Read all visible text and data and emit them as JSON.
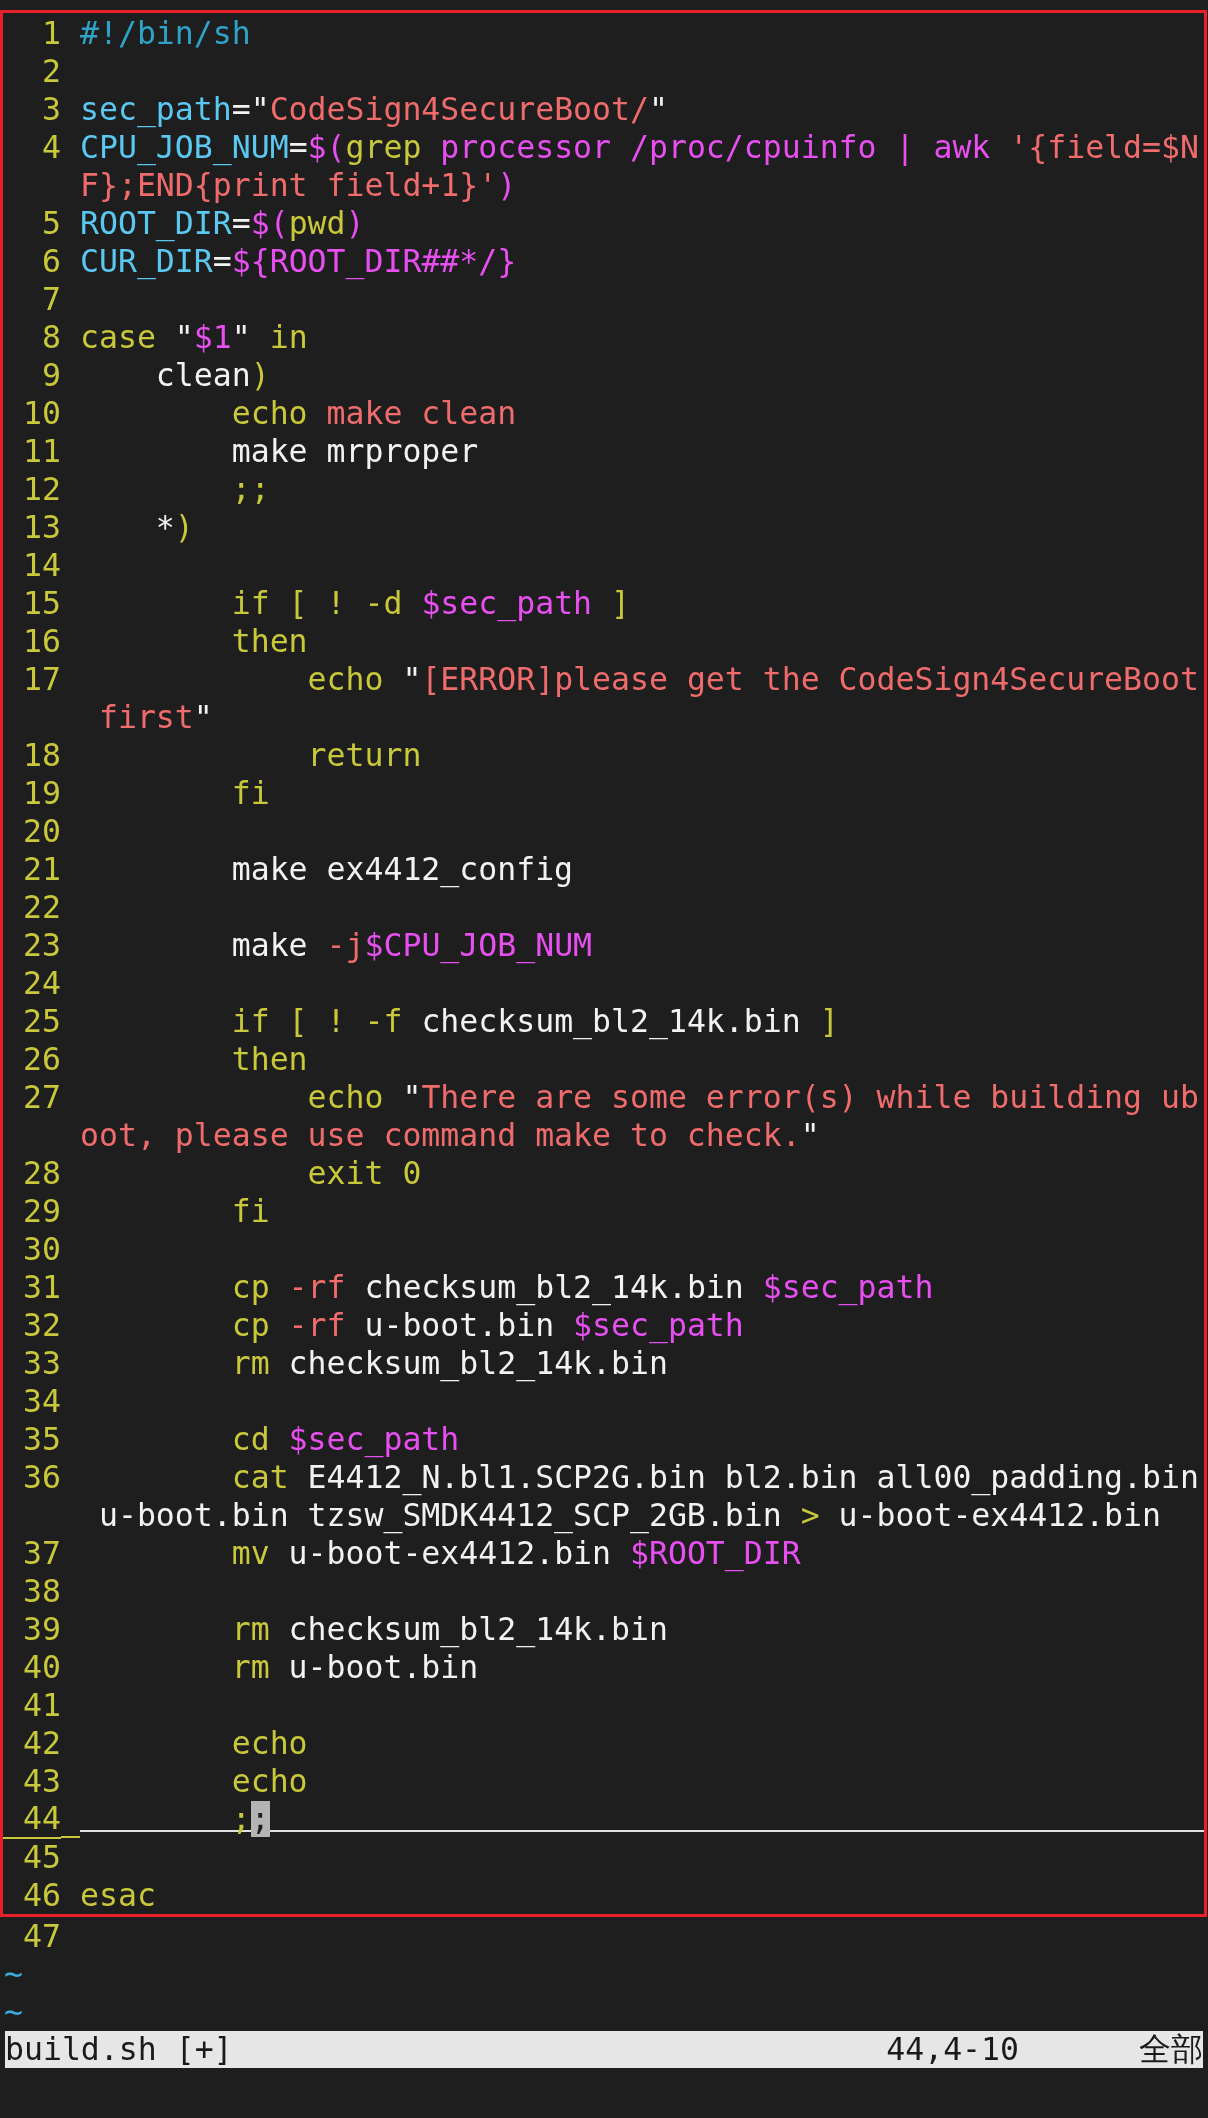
{
  "editor": {
    "framed_lines": [
      {
        "number": "1",
        "segments": [
          {
            "kind": "comment",
            "text": "#!/bin/sh"
          }
        ]
      },
      {
        "number": "2"
      },
      {
        "number": "3",
        "segments": [
          {
            "kind": "identifier",
            "text": "sec_path"
          },
          {
            "kind": "plain",
            "text": "=\""
          },
          {
            "kind": "string",
            "text": "CodeSign4SecureBoot/"
          },
          {
            "kind": "plain",
            "text": "\""
          }
        ]
      },
      {
        "number": "4",
        "segments": [
          {
            "kind": "identifier",
            "text": "CPU_JOB_NUM"
          },
          {
            "kind": "plain",
            "text": "="
          },
          {
            "kind": "variable",
            "text": "$("
          },
          {
            "kind": "keyword",
            "text": "grep"
          },
          {
            "kind": "variable",
            "text": " processor /proc/cpuinfo | awk "
          },
          {
            "kind": "string",
            "text": "'{field=$N"
          }
        ],
        "continuation": [
          {
            "kind": "string",
            "text": "F};END{print field+1}'"
          },
          {
            "kind": "variable",
            "text": ")"
          }
        ]
      },
      {
        "number": "5",
        "segments": [
          {
            "kind": "identifier",
            "text": "ROOT_DIR"
          },
          {
            "kind": "plain",
            "text": "="
          },
          {
            "kind": "variable",
            "text": "$("
          },
          {
            "kind": "keyword",
            "text": "pwd"
          },
          {
            "kind": "variable",
            "text": ")"
          }
        ]
      },
      {
        "number": "6",
        "segments": [
          {
            "kind": "identifier",
            "text": "CUR_DIR"
          },
          {
            "kind": "plain",
            "text": "="
          },
          {
            "kind": "variable",
            "text": "${ROOT_DIR##*/}"
          }
        ]
      },
      {
        "number": "7"
      },
      {
        "number": "8",
        "segments": [
          {
            "kind": "keyword",
            "text": "case "
          },
          {
            "kind": "plain",
            "text": "\""
          },
          {
            "kind": "variable",
            "text": "$1"
          },
          {
            "kind": "plain",
            "text": "\""
          },
          {
            "kind": "keyword",
            "text": " in"
          }
        ]
      },
      {
        "number": "9",
        "segments": [
          {
            "kind": "plain",
            "text": "    clean"
          },
          {
            "kind": "keyword",
            "text": ")"
          }
        ]
      },
      {
        "number": "10",
        "segments": [
          {
            "kind": "keyword",
            "text": "        echo"
          },
          {
            "kind": "string",
            "text": " make clean"
          }
        ]
      },
      {
        "number": "11",
        "segments": [
          {
            "kind": "plain",
            "text": "        make mrproper"
          }
        ]
      },
      {
        "number": "12",
        "segments": [
          {
            "kind": "keyword",
            "text": "        ;;"
          }
        ]
      },
      {
        "number": "13",
        "segments": [
          {
            "kind": "plain",
            "text": "    *"
          },
          {
            "kind": "keyword",
            "text": ")"
          }
        ]
      },
      {
        "number": "14"
      },
      {
        "number": "15",
        "segments": [
          {
            "kind": "keyword",
            "text": "        if [ ! -d "
          },
          {
            "kind": "variable",
            "text": "$sec_path"
          },
          {
            "kind": "keyword",
            "text": " ]"
          }
        ]
      },
      {
        "number": "16",
        "segments": [
          {
            "kind": "keyword",
            "text": "        then"
          }
        ]
      },
      {
        "number": "17",
        "segments": [
          {
            "kind": "keyword",
            "text": "            echo"
          },
          {
            "kind": "plain",
            "text": " \""
          },
          {
            "kind": "string",
            "text": "[ERROR]please get the CodeSign4SecureBoot"
          }
        ],
        "continuation": [
          {
            "kind": "string",
            "text": " first"
          },
          {
            "kind": "plain",
            "text": "\""
          }
        ]
      },
      {
        "number": "18",
        "segments": [
          {
            "kind": "keyword",
            "text": "            return"
          }
        ]
      },
      {
        "number": "19",
        "segments": [
          {
            "kind": "keyword",
            "text": "        fi"
          }
        ]
      },
      {
        "number": "20"
      },
      {
        "number": "21",
        "segments": [
          {
            "kind": "plain",
            "text": "        make ex4412_config"
          }
        ]
      },
      {
        "number": "22"
      },
      {
        "number": "23",
        "segments": [
          {
            "kind": "plain",
            "text": "        make "
          },
          {
            "kind": "string",
            "text": "-j"
          },
          {
            "kind": "variable",
            "text": "$CPU_JOB_NUM"
          }
        ]
      },
      {
        "number": "24"
      },
      {
        "number": "25",
        "segments": [
          {
            "kind": "keyword",
            "text": "        if [ ! -f "
          },
          {
            "kind": "plain",
            "text": "checksum_bl2_14k.bin"
          },
          {
            "kind": "keyword",
            "text": " ]"
          }
        ]
      },
      {
        "number": "26",
        "segments": [
          {
            "kind": "keyword",
            "text": "        then"
          }
        ]
      },
      {
        "number": "27",
        "segments": [
          {
            "kind": "keyword",
            "text": "            echo"
          },
          {
            "kind": "plain",
            "text": " \""
          },
          {
            "kind": "string",
            "text": "There are some error(s) while building ub"
          }
        ],
        "continuation": [
          {
            "kind": "string",
            "text": "oot, please use command make to check."
          },
          {
            "kind": "plain",
            "text": "\""
          }
        ]
      },
      {
        "number": "28",
        "segments": [
          {
            "kind": "keyword",
            "text": "            exit 0"
          }
        ]
      },
      {
        "number": "29",
        "segments": [
          {
            "kind": "keyword",
            "text": "        fi"
          }
        ]
      },
      {
        "number": "30"
      },
      {
        "number": "31",
        "segments": [
          {
            "kind": "keyword",
            "text": "        cp"
          },
          {
            "kind": "string",
            "text": " -rf"
          },
          {
            "kind": "plain",
            "text": " checksum_bl2_14k.bin "
          },
          {
            "kind": "variable",
            "text": "$sec_path"
          }
        ]
      },
      {
        "number": "32",
        "segments": [
          {
            "kind": "keyword",
            "text": "        cp"
          },
          {
            "kind": "string",
            "text": " -rf"
          },
          {
            "kind": "plain",
            "text": " u-boot.bin "
          },
          {
            "kind": "variable",
            "text": "$sec_path"
          }
        ]
      },
      {
        "number": "33",
        "segments": [
          {
            "kind": "keyword",
            "text": "        rm"
          },
          {
            "kind": "plain",
            "text": " checksum_bl2_14k.bin"
          }
        ]
      },
      {
        "number": "34"
      },
      {
        "number": "35",
        "segments": [
          {
            "kind": "keyword",
            "text": "        cd"
          },
          {
            "kind": "variable",
            "text": " $sec_path"
          }
        ]
      },
      {
        "number": "36",
        "segments": [
          {
            "kind": "keyword",
            "text": "        cat"
          },
          {
            "kind": "plain",
            "text": " E4412_N.bl1.SCP2G.bin bl2.bin all00_padding.bin"
          }
        ],
        "continuation": [
          {
            "kind": "plain",
            "text": " u-boot.bin tzsw_SMDK4412_SCP_2GB.bin "
          },
          {
            "kind": "keyword",
            "text": ">"
          },
          {
            "kind": "plain",
            "text": " u-boot-ex4412.bin"
          }
        ]
      },
      {
        "number": "37",
        "segments": [
          {
            "kind": "keyword",
            "text": "        mv"
          },
          {
            "kind": "plain",
            "text": " u-boot-ex4412.bin "
          },
          {
            "kind": "variable",
            "text": "$ROOT_DIR"
          }
        ]
      },
      {
        "number": "38"
      },
      {
        "number": "39",
        "segments": [
          {
            "kind": "keyword",
            "text": "        rm"
          },
          {
            "kind": "plain",
            "text": " checksum_bl2_14k.bin"
          }
        ]
      },
      {
        "number": "40",
        "segments": [
          {
            "kind": "keyword",
            "text": "        rm"
          },
          {
            "kind": "plain",
            "text": " u-boot.bin"
          }
        ]
      },
      {
        "number": "41"
      },
      {
        "number": "42",
        "segments": [
          {
            "kind": "keyword",
            "text": "        echo"
          }
        ]
      },
      {
        "number": "43",
        "segments": [
          {
            "kind": "keyword",
            "text": "        echo"
          }
        ]
      },
      {
        "number": "44",
        "cursor_line": true,
        "segments": [
          {
            "kind": "keyword",
            "text": "        ;"
          },
          {
            "kind": "cursor",
            "text": ";"
          }
        ]
      },
      {
        "number": "45"
      },
      {
        "number": "46",
        "segments": [
          {
            "kind": "keyword",
            "text": "esac"
          }
        ]
      }
    ],
    "lines": [
      {
        "number": "47"
      }
    ],
    "tildes": [
      "~",
      "~"
    ]
  },
  "status_bar": {
    "file": "build.sh [+]",
    "position": "44,4-10",
    "scroll": "全部"
  }
}
